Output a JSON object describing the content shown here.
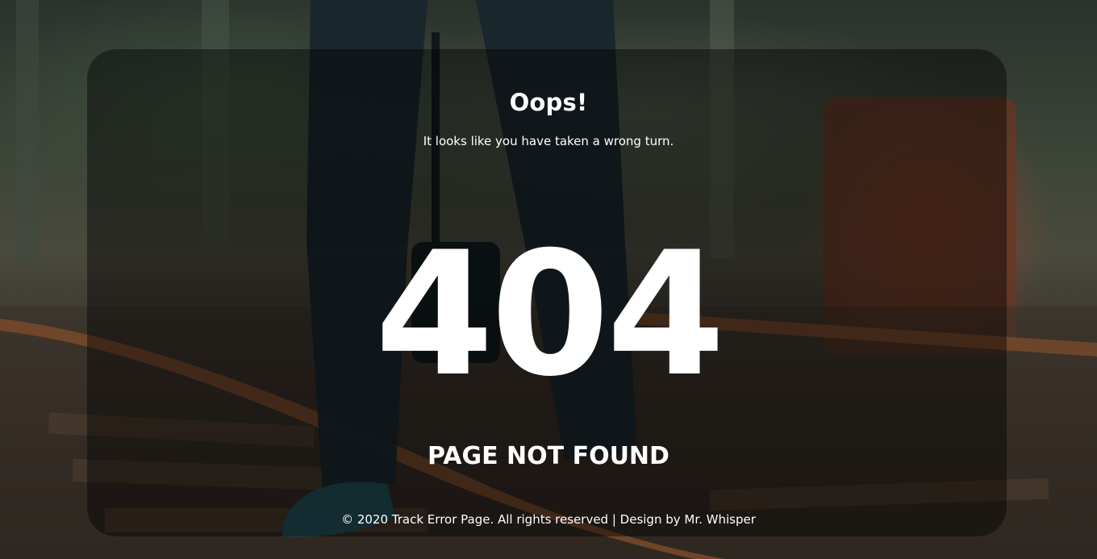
{
  "heading": "Oops!",
  "subheading": "It looks like you have taken a wrong turn.",
  "error_code": "404",
  "error_message": "PAGE NOT FOUND",
  "footer_text": "© 2020 Track Error Page. All rights reserved | Design by Mr. Whisper",
  "colors": {
    "text": "#ffffff",
    "card_overlay": "rgba(0,0,0,0.42)"
  }
}
